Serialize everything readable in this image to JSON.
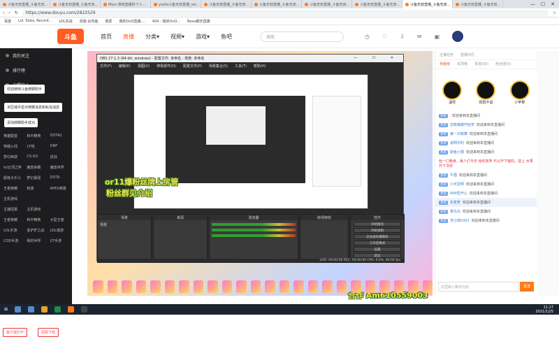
{
  "browser": {
    "tabs": [
      "斗鱼无双直播_斗鱼无双...",
      "斗鱼无双直播_斗鱼无双...",
      "Miyo-游戏直播的个人...",
      "yuefa斗鱼无双直播_sol...",
      "斗鱼无双直播_斗鱼无双...",
      "斗鱼无双直播_斗鱼无双...",
      "斗鱼无双直播_斗鱼无双...",
      "斗鱼无双直播_斗鱼无双...",
      "斗鱼无双直播_斗鱼无双...",
      "斗鱼无双直播_斗鱼无双..."
    ],
    "address": "https://www.douyu.com/2822529",
    "bookmarks": [
      "百度",
      "Lol. Stats, Record...",
      "LOL实战",
      "百度-白鸡鱼",
      "我爱",
      "我的OvO直播-...",
      "404 - 我的OvO...",
      "Nova聊天直播"
    ]
  },
  "header": {
    "logo": "斗鱼",
    "nav": [
      "首页",
      "直播",
      "分类▾",
      "视频▾",
      "游戏▾",
      "鱼吧"
    ],
    "search_placeholder": "搜索"
  },
  "sidebar": {
    "items": [
      "我的关注",
      "排行榜",
      "习惯中心"
    ],
    "toasts": [
      "欢迎使用斗鱼牌脚助手",
      "本区域中显示牌脚消息和私信消息",
      "添加牌脚助手成功"
    ],
    "grid": [
      "英雄联盟",
      "和平精英",
      "DOTA2",
      "穿越火线",
      "CF枪",
      "DNF",
      "梦幻西游",
      "CS:GO",
      "逆战",
      "lol云顶之弈",
      "魔兽争霸",
      "魔兽世界",
      "超级大乐斗",
      "梦幻最强",
      "DOTA",
      "王者荣耀",
      "刺激",
      "APEX英雄",
      "主机游戏",
      "",
      "",
      "主播招募",
      "主机游戏",
      "",
      "王者荣耀",
      "和平精英",
      "大型王者",
      "LOL手游",
      "金铲铲之战",
      "LOL端游",
      "COD手游",
      "我的世界",
      "CF手游"
    ],
    "buttons": [
      "客户端打开",
      "视频下载"
    ]
  },
  "stage": {
    "obs_title": "OBS 27.1.3 (64-bit, windows) - 配置文件: 未命名 - 场景: 未命名",
    "obs_menu": [
      "文件(F)",
      "编辑(E)",
      "视图(V)",
      "停靠部件(D)",
      "配置文件(P)",
      "场景集合(S)",
      "工具(T)",
      "帮助(H)"
    ],
    "panels": [
      "场景",
      "来源",
      "混音器",
      "转场特效",
      "控件"
    ],
    "controls": [
      "开始推流",
      "开始录制",
      "启动虚拟摄像机",
      "工作室模式",
      "设置",
      "退出"
    ],
    "status": "LIVE: 00:00:00   REC: 00:00:00   CPU: 0.6%, 60.00 fps",
    "overlay1": "or11爆粉丝牌上房管",
    "overlay2": "粉丝群见介绍",
    "overlay3": "合作 Am610559003",
    "scene_item": "场景"
  },
  "right": {
    "tabs": [
      "主播任务",
      "直播日历"
    ],
    "rank_tabs": [
      "贡献榜",
      "本周榜",
      "贵宾(60)",
      "粉丝团(0)"
    ],
    "rank_names": [
      "温咩",
      "阳阳不退",
      "小苹果"
    ],
    "chat": [
      {
        "badge": "贵宾",
        "name": "",
        "text": "欢迎来到本直播间"
      },
      {
        "badge": "贵宾",
        "name": "恋桃蝴蝶开始学",
        "text": "欢迎来到本直播间"
      },
      {
        "badge": "贵宾",
        "name": "第一次跳舞",
        "text": "欢迎来到本直播间"
      },
      {
        "badge": "贵宾",
        "name": "说明中的",
        "text": "欢迎来到本直播间"
      },
      {
        "badge": "贵宾",
        "name": "斯鱼小丽",
        "text": "欢迎来到本直播间"
      },
      {
        "badge": "贵宾",
        "name": "不遇",
        "text": "欢迎来到本直播间"
      },
      {
        "badge": "贵宾",
        "name": "小可爱啊",
        "text": "欢迎来到本直播间"
      },
      {
        "badge": "贵宾",
        "name": "WW爱开心",
        "text": "欢迎来到本直播间"
      },
      {
        "badge": "贵宾",
        "name": "东笙笙",
        "text": "欢迎来到本直播间"
      },
      {
        "badge": "贵宾",
        "name": "菜鸟鸟",
        "text": "欢迎来到本直播间"
      },
      {
        "badge": "贵宾",
        "name": "苏小妹0301",
        "text": "欢迎来到本直播间"
      }
    ],
    "notice": "给一口粮食，美人们今天 给你放弃 可以开下轴吗，送上 水果开下寻欢",
    "input_placeholder": "这里输入聊天内容",
    "send": "发送"
  },
  "taskbar": {
    "time": "11:17",
    "date": "2021/12/5"
  }
}
